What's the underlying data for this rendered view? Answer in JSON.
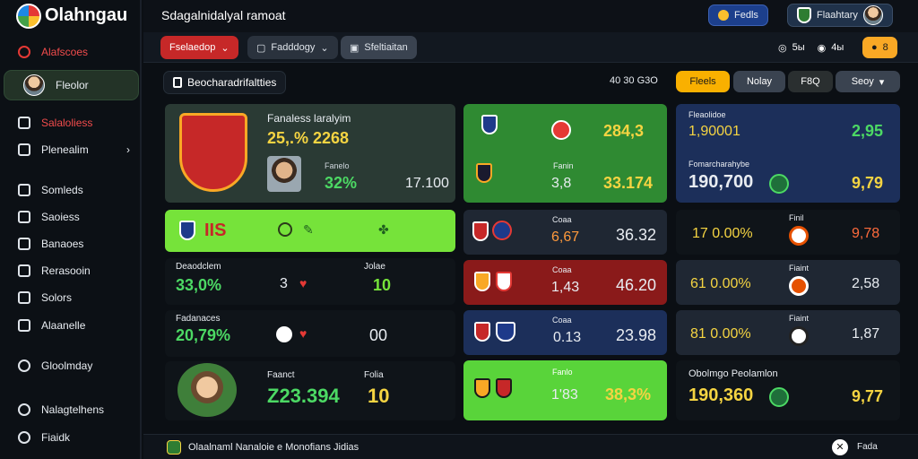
{
  "app": {
    "name": "Olahngau"
  },
  "sidebar": {
    "items": [
      {
        "label": "Alafscoes",
        "icon": "target-icon"
      },
      {
        "label": "Fleolor",
        "icon": "avatar"
      },
      {
        "label": "Salaloliess",
        "icon": "home-icon"
      },
      {
        "label": "Plenealim",
        "icon": "folder-icon",
        "chevron": "›"
      },
      {
        "label": "Somleds",
        "icon": "list-icon"
      },
      {
        "label": "Saoiess",
        "icon": "grid-icon"
      },
      {
        "label": "Banaoes",
        "icon": "calendar-icon"
      },
      {
        "label": "Rerasooin",
        "icon": "gear-icon"
      },
      {
        "label": "Solors",
        "icon": "tag-icon"
      },
      {
        "label": "Alaanelle",
        "icon": "chart-icon"
      },
      {
        "label": "Gloolmday",
        "icon": "bell-icon"
      },
      {
        "label": "Nalagtelhens",
        "icon": "globe-icon"
      },
      {
        "label": "Fiaidk",
        "icon": "info-icon"
      }
    ]
  },
  "header": {
    "title": "Sdagalnidalyal ramoat",
    "btn1": "Fedls",
    "user": "Flaahtary"
  },
  "toolbar": {
    "dropdown": "Fselaedop",
    "tab1": "Fadddogy",
    "tab2": "Sfeltiaitan",
    "counter1": "5ы",
    "counter2": "4ы",
    "counter3": "8"
  },
  "search": {
    "label": "Beocharadrifaltties"
  },
  "filters": {
    "odds": "40 30 G3O",
    "f1": "Fleels",
    "f2": "Nolay",
    "f3": "F8Q",
    "f4": "Seoy"
  },
  "featured": {
    "title": "Fanaless laralyim",
    "score": "25,.% 2268",
    "label": "Fanelo",
    "pct": "32%",
    "value": "17.100"
  },
  "green_bar": {
    "text": "IIS"
  },
  "left_rows": [
    {
      "label": "Deaodclem",
      "pct": "33,0%",
      "n": "3",
      "label2": "Jolae",
      "val": "10"
    },
    {
      "label": "Fadanaces",
      "pct": "20,79%",
      "n": "",
      "label2": "",
      "val": "00"
    },
    {
      "label": "Faanct",
      "pct": "Z23.394",
      "n": "",
      "label2": "Folia",
      "val": "10"
    }
  ],
  "mid_cards": [
    {
      "a": "284,3",
      "l": "Fanin",
      "b": "3,8",
      "c": "33.174"
    },
    {
      "l": "Coaa",
      "b": "6,67",
      "c": "36.32"
    },
    {
      "l": "Coaa",
      "b": "1,43",
      "c": "46.20"
    },
    {
      "l": "Coaa",
      "b": "0.13",
      "c": "23.98"
    },
    {
      "l": "Fanlo",
      "b": "1'83",
      "c": "38,3%"
    }
  ],
  "right_cards": [
    {
      "l": "Fleaolidoe",
      "a": "1,90001",
      "b": "2,95",
      "l2": "Fomarcharahybe",
      "c": "190,700",
      "d": "9,79"
    },
    {
      "l": "Finil",
      "a": "17 0.00%",
      "b": "9,78"
    },
    {
      "l": "Fiaint",
      "a": "61 0.00%",
      "b": "2,58"
    },
    {
      "l": "Fiaint",
      "a": "81 0.00%",
      "b": "1,87"
    },
    {
      "l": "Obolmgo Peolamlon",
      "a": "190,360",
      "b": "9,77"
    }
  ],
  "footer": {
    "text": "Olaalnaml Nanaloie e Monofians Jidias",
    "right": "Fada"
  }
}
